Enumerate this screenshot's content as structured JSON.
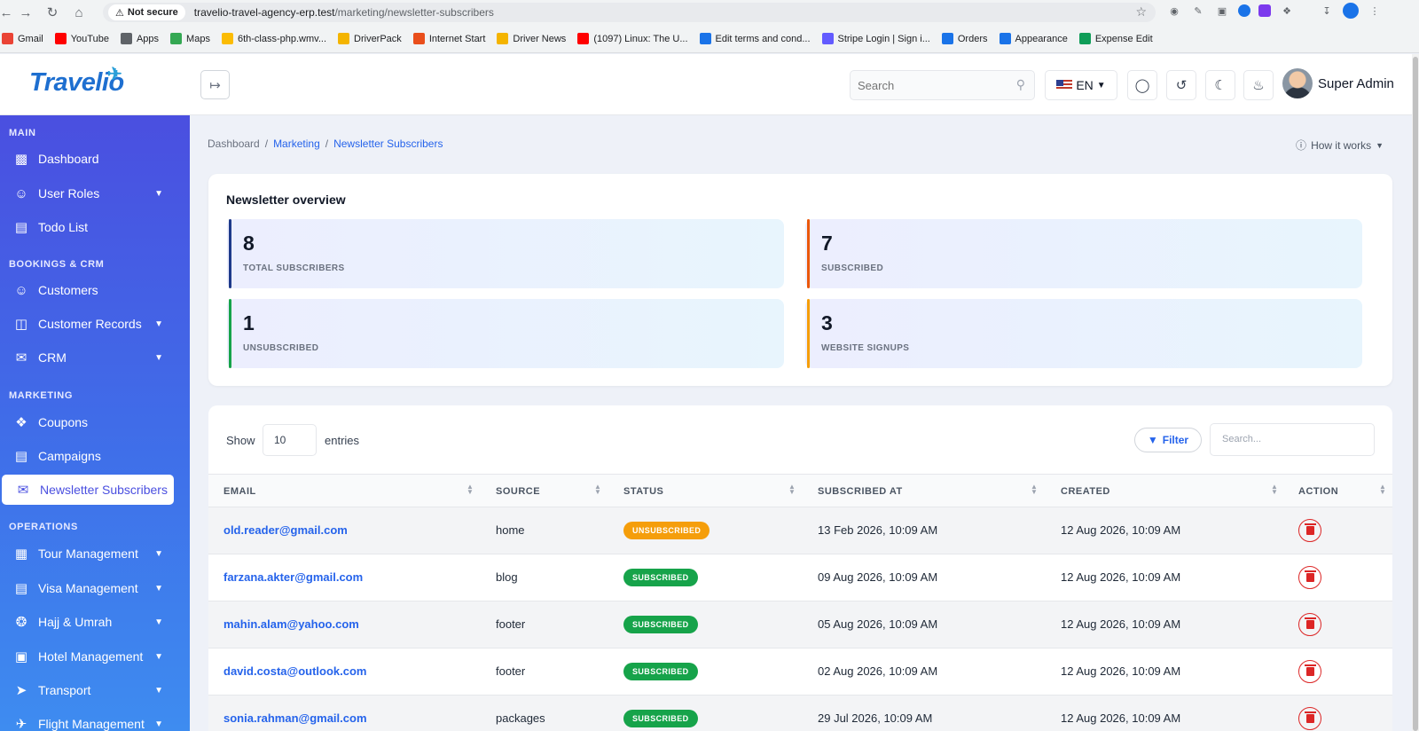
{
  "browser": {
    "security_label": "Not secure",
    "url_host": "travelio-travel-agency-erp.test",
    "url_path": "/marketing/newsletter-subscribers",
    "bookmarks": [
      {
        "label": "Gmail",
        "color": "#ea4335"
      },
      {
        "label": "YouTube",
        "color": "#ff0000"
      },
      {
        "label": "Apps",
        "color": "#5f6368"
      },
      {
        "label": "Maps",
        "color": "#34a853"
      },
      {
        "label": "6th-class-php.wmv...",
        "color": "#fbbc04"
      },
      {
        "label": "DriverPack",
        "color": "#f4b400"
      },
      {
        "label": "Internet Start",
        "color": "#e94e1b"
      },
      {
        "label": "Driver News",
        "color": "#f4b400"
      },
      {
        "label": "(1097) Linux: The U...",
        "color": "#ff0000"
      },
      {
        "label": "Edit terms and cond...",
        "color": "#1a73e8"
      },
      {
        "label": "Stripe Login | Sign i...",
        "color": "#635bff"
      },
      {
        "label": "Orders",
        "color": "#1a73e8"
      },
      {
        "label": "Appearance",
        "color": "#1a73e8"
      },
      {
        "label": "Expense Edit",
        "color": "#0f9d58"
      }
    ]
  },
  "header": {
    "logo": "Travelio",
    "search_placeholder": "Search",
    "language": "EN",
    "user_name": "Super Admin"
  },
  "sidebar": {
    "sections": {
      "main": "MAIN",
      "bookings": "BOOKINGS & CRM",
      "marketing": "MARKETING",
      "operations": "OPERATIONS"
    },
    "items": {
      "dashboard": "Dashboard",
      "user_roles": "User Roles",
      "todo": "Todo List",
      "customers": "Customers",
      "customer_records": "Customer Records",
      "crm": "CRM",
      "coupons": "Coupons",
      "campaigns": "Campaigns",
      "newsletter": "Newsletter Subscribers",
      "tour": "Tour Management",
      "visa": "Visa Management",
      "hajj": "Hajj & Umrah",
      "hotel": "Hotel Management",
      "transport": "Transport",
      "flight": "Flight Management"
    }
  },
  "breadcrumb": {
    "home": "Dashboard",
    "sep": "/",
    "parent": "Marketing",
    "current": "Newsletter Subscribers"
  },
  "how_it_works": "How it works",
  "overview": {
    "title": "Newsletter overview",
    "stats": [
      {
        "value": "8",
        "label": "TOTAL SUBSCRIBERS",
        "color": "#1e3a8a"
      },
      {
        "value": "7",
        "label": "SUBSCRIBED",
        "color": "#ea580c"
      },
      {
        "value": "1",
        "label": "UNSUBSCRIBED",
        "color": "#16a34a"
      },
      {
        "value": "3",
        "label": "WEBSITE SIGNUPS",
        "color": "#f59e0b"
      }
    ]
  },
  "table": {
    "show_label": "Show",
    "entries_value": "10",
    "entries_label": "entries",
    "filter_label": "Filter",
    "search_placeholder": "Search...",
    "columns": [
      "EMAIL",
      "SOURCE",
      "STATUS",
      "SUBSCRIBED AT",
      "CREATED",
      "ACTION"
    ],
    "rows": [
      {
        "email": "old.reader@gmail.com",
        "source": "home",
        "status": "UNSUBSCRIBED",
        "subscribed_at": "13 Feb 2026, 10:09 AM",
        "created": "12 Aug 2026, 10:09 AM"
      },
      {
        "email": "farzana.akter@gmail.com",
        "source": "blog",
        "status": "SUBSCRIBED",
        "subscribed_at": "09 Aug 2026, 10:09 AM",
        "created": "12 Aug 2026, 10:09 AM"
      },
      {
        "email": "mahin.alam@yahoo.com",
        "source": "footer",
        "status": "SUBSCRIBED",
        "subscribed_at": "05 Aug 2026, 10:09 AM",
        "created": "12 Aug 2026, 10:09 AM"
      },
      {
        "email": "david.costa@outlook.com",
        "source": "footer",
        "status": "SUBSCRIBED",
        "subscribed_at": "02 Aug 2026, 10:09 AM",
        "created": "12 Aug 2026, 10:09 AM"
      },
      {
        "email": "sonia.rahman@gmail.com",
        "source": "packages",
        "status": "SUBSCRIBED",
        "subscribed_at": "29 Jul 2026, 10:09 AM",
        "created": "12 Aug 2026, 10:09 AM"
      }
    ]
  }
}
